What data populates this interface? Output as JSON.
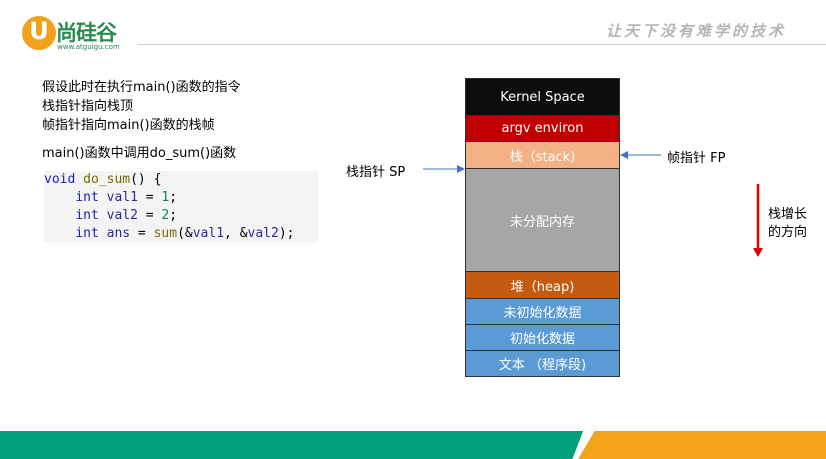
{
  "header": {
    "logo_letter": "U",
    "logo_text": "尚硅谷",
    "logo_url": "www.atguigu.com",
    "slogan": "让天下没有难学的技术"
  },
  "text": {
    "line1": "假设此时在执行main()函数的指令",
    "line2": "栈指针指向栈顶",
    "line3": "帧指针指向main()函数的栈帧",
    "line4": "main()函数中调用do_sum()函数"
  },
  "code": {
    "l1_kw": "void",
    "l1_fn": "do_sum",
    "l1_rest": "() {",
    "l2_kw": "int",
    "l2_id": "val1",
    "l2_eq": " = ",
    "l2_num": "1",
    "l2_end": ";",
    "l3_kw": "int",
    "l3_id": "val2",
    "l3_eq": " = ",
    "l3_num": "2",
    "l3_end": ";",
    "l4_kw": "int",
    "l4_id": "ans",
    "l4_eq": " = ",
    "l4_fn": "sum",
    "l4_open": "(&",
    "l4_a1": "val1",
    "l4_sep": ", &",
    "l4_a2": "val2",
    "l4_end": ");"
  },
  "memory": {
    "kernel": "Kernel Space",
    "argv": "argv environ",
    "stack": "栈（stack)",
    "free": "未分配内存",
    "heap": "堆（heap)",
    "uninit": "未初始化数据",
    "init": "初始化数据",
    "text": "文本 （程序段)"
  },
  "labels": {
    "sp": "栈指针 SP",
    "fp": "帧指针 FP",
    "grow_line1": "栈增长",
    "grow_line2": "的方向"
  },
  "colors": {
    "brand_green": "#00a07c",
    "brand_orange": "#f5a31a",
    "arrow_blue": "#4472c4",
    "arrow_red": "#e00000"
  }
}
